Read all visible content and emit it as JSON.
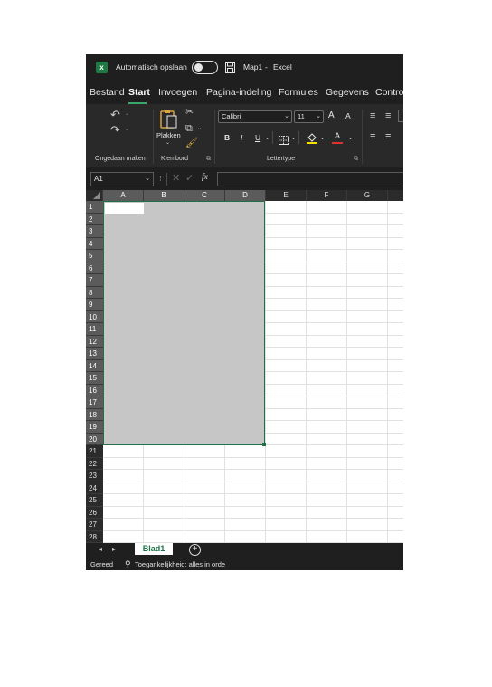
{
  "title_bar": {
    "app_icon": "excel-logo-icon",
    "autosave_label": "Automatisch opslaan",
    "autosave_state": "off",
    "save_icon": "save-icon",
    "document_title": "Map1",
    "separator": "-",
    "app_name": "Excel"
  },
  "ribbon_tabs": [
    {
      "label": "Bestand"
    },
    {
      "label": "Start",
      "active": true
    },
    {
      "label": "Invoegen"
    },
    {
      "label": "Pagina-indeling"
    },
    {
      "label": "Formules"
    },
    {
      "label": "Gegevens"
    },
    {
      "label": "Controle"
    }
  ],
  "ribbon": {
    "undo_group": {
      "undo_icon": "undo-icon",
      "redo_icon": "redo-icon",
      "label": "Ongedaan maken"
    },
    "clipboard_group": {
      "paste_label": "Plakken",
      "cut_icon": "scissors-icon",
      "copy_icon": "copy-icon",
      "format_painter_icon": "format-painter-icon",
      "label": "Klembord"
    },
    "font_group": {
      "font_name": "Calibri",
      "font_size": "11",
      "bold": "B",
      "italic": "I",
      "underline": "U",
      "grow_icon": "A",
      "shrink_icon": "A",
      "fill_icon": "fill-color-icon",
      "font_color": "A",
      "label": "Lettertype"
    },
    "alignment_icons": [
      "align-top-icon",
      "align-middle-icon",
      "align-left-icon",
      "align-center-icon"
    ]
  },
  "formula_bar": {
    "name_box": "A1",
    "cancel_icon": "close-icon",
    "enter_icon": "check-icon",
    "fx_label": "fx",
    "formula_value": ""
  },
  "columns": [
    "A",
    "B",
    "C",
    "D",
    "E",
    "F",
    "G"
  ],
  "rows": [
    "1",
    "2",
    "3",
    "4",
    "5",
    "6",
    "7",
    "8",
    "9",
    "10",
    "11",
    "12",
    "13",
    "14",
    "15",
    "16",
    "17",
    "18",
    "19",
    "20",
    "21",
    "22",
    "23",
    "24",
    "25",
    "26",
    "27",
    "28"
  ],
  "selection": {
    "range": "A1:D20",
    "active_cell": "A1"
  },
  "sheet_tabs": {
    "tabs": [
      "Blad1"
    ],
    "active": "Blad1"
  },
  "status_bar": {
    "ready": "Gereed",
    "accessibility": "Toegankelijkheid: alles in orde"
  },
  "colors": {
    "accent": "#1e7145",
    "selection_fill": "#c6c6c6",
    "chrome_dark": "#1f1f1f"
  }
}
